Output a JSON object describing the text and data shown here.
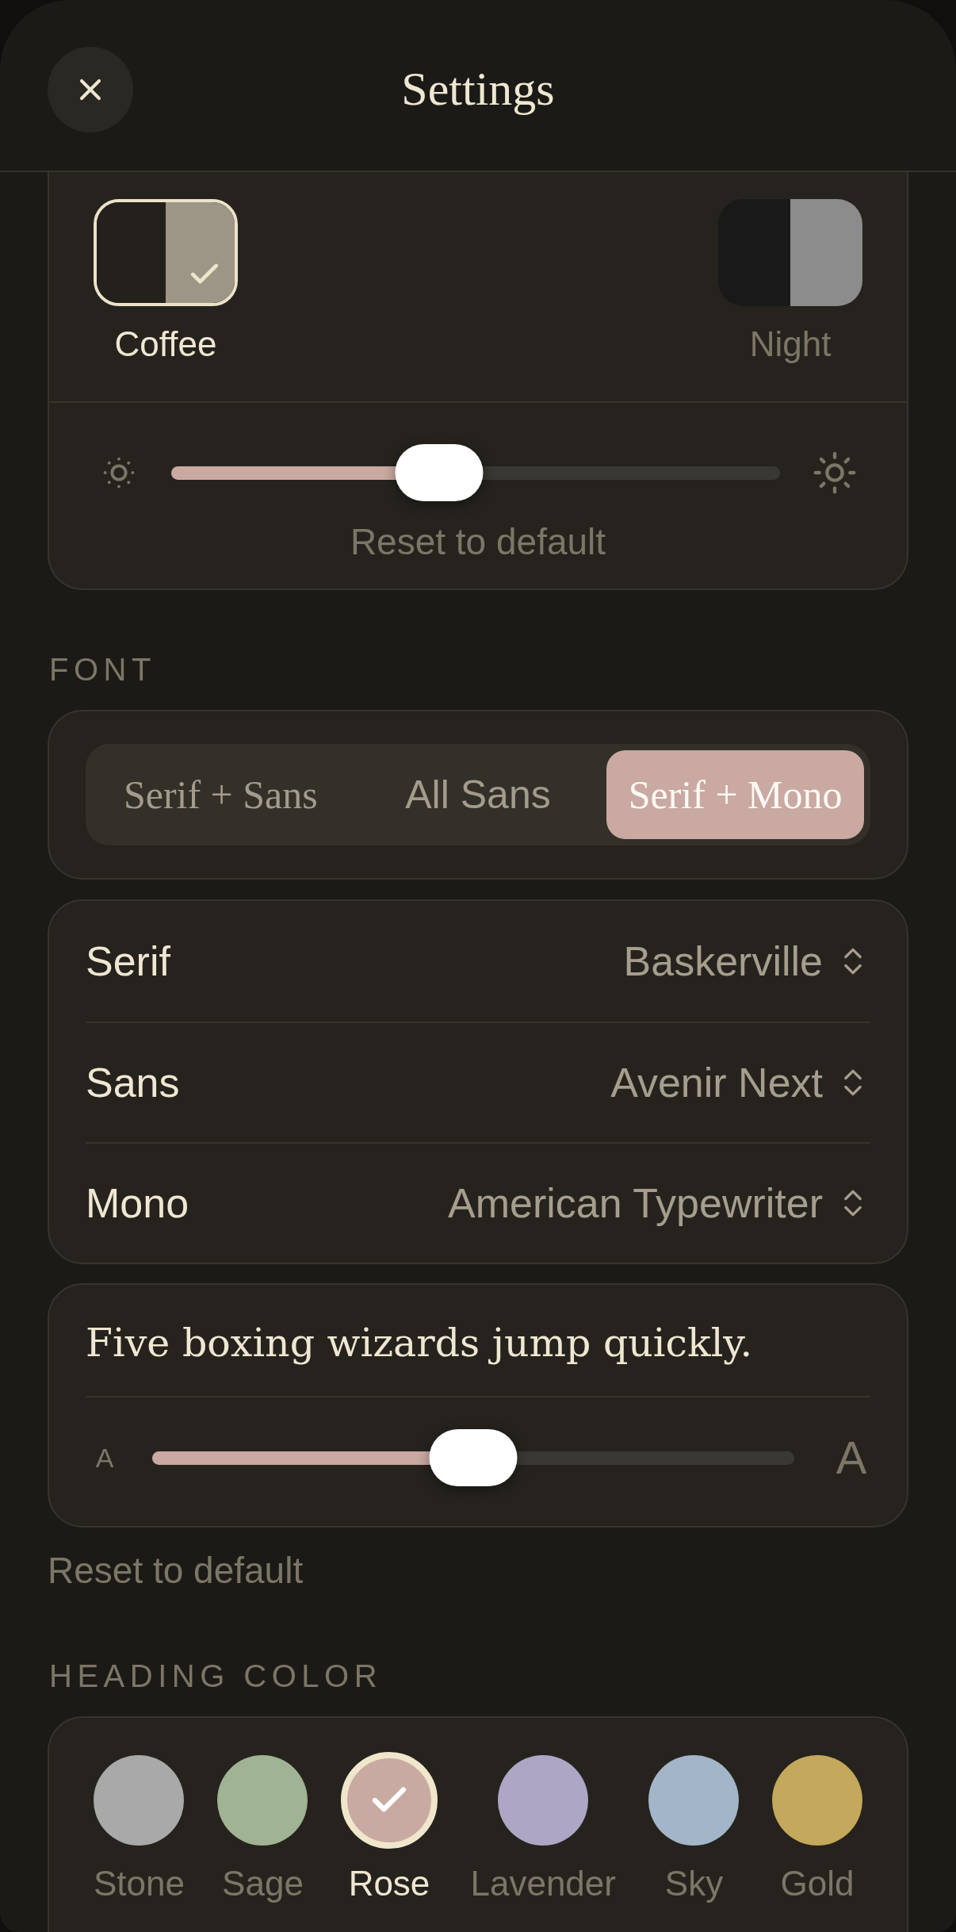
{
  "header": {
    "title": "Settings"
  },
  "themes": [
    {
      "name": "Coffee",
      "halves": [
        {
          "color": "#24211c"
        },
        {
          "color": "#9d9686"
        }
      ],
      "selected": true
    },
    {
      "name": "Night",
      "halves": [
        {
          "color": "#191919"
        },
        {
          "color": "#8c8c8c"
        }
      ],
      "selected": false
    }
  ],
  "brightness": {
    "level": 0.44,
    "reset_label": "Reset to default"
  },
  "font": {
    "heading": "FONT",
    "options": [
      {
        "label": "Serif + Sans",
        "kind": "serif",
        "selected": false
      },
      {
        "label": "All Sans",
        "kind": "sans",
        "selected": false
      },
      {
        "label": "Serif + Mono",
        "kind": "serif",
        "selected": true
      }
    ],
    "rows": [
      {
        "label": "Serif",
        "value": "Baskerville"
      },
      {
        "label": "Sans",
        "value": "Avenir Next"
      },
      {
        "label": "Mono",
        "value": "American Typewriter"
      }
    ],
    "preview": {
      "text": "Five boxing wizards jump quickly.",
      "small_glyph": "A",
      "large_glyph": "A",
      "level": 0.5
    },
    "reset_label": "Reset to default"
  },
  "heading_color": {
    "heading": "HEADING COLOR",
    "swatches": [
      {
        "name": "Stone",
        "color": "#a9a9a9",
        "selected": false
      },
      {
        "name": "Sage",
        "color": "#a0b393",
        "selected": false
      },
      {
        "name": "Rose",
        "color": "#c9aaa2",
        "selected": true
      },
      {
        "name": "Lavender",
        "color": "#ada6c5",
        "selected": false
      },
      {
        "name": "Sky",
        "color": "#a3b5c8",
        "selected": false
      },
      {
        "name": "Gold",
        "color": "#c4a85b",
        "selected": false
      }
    ]
  }
}
